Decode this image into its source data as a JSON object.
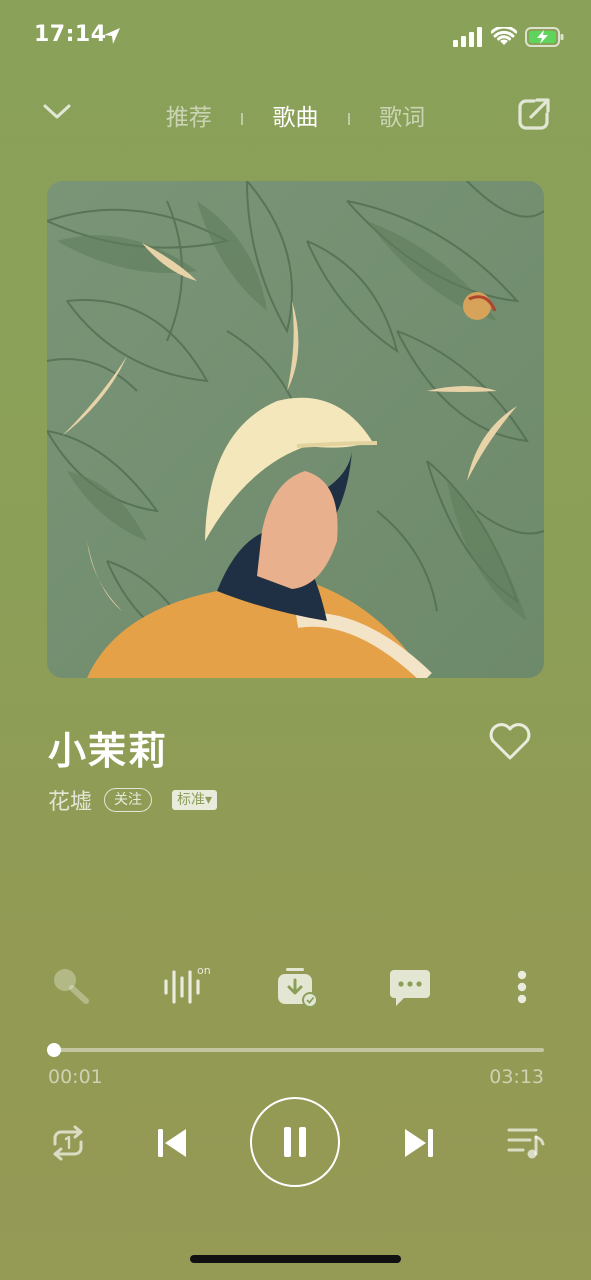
{
  "status_bar": {
    "time": "17:14"
  },
  "header": {
    "tabs": [
      {
        "label": "推荐",
        "active": false
      },
      {
        "label": "歌曲",
        "active": true
      },
      {
        "label": "歌词",
        "active": false
      }
    ]
  },
  "song": {
    "title": "小茉莉",
    "artist": "花墟",
    "follow_label": "关注",
    "quality_label": "标准▾",
    "liked": false
  },
  "actions": {
    "voice_effect_badge": "on"
  },
  "playback": {
    "current_time": "00:01",
    "total_time": "03:13",
    "progress": 0.005,
    "state": "playing"
  },
  "colors": {
    "background": "#8c9f57",
    "accent": "#ffffff"
  },
  "icons": [
    "chevron-down-icon",
    "share-icon",
    "heart-icon",
    "karaoke-mic-icon",
    "sound-wave-icon",
    "download-icon",
    "comment-icon",
    "more-icon",
    "repeat-icon",
    "previous-icon",
    "pause-icon",
    "next-icon",
    "playlist-icon"
  ]
}
